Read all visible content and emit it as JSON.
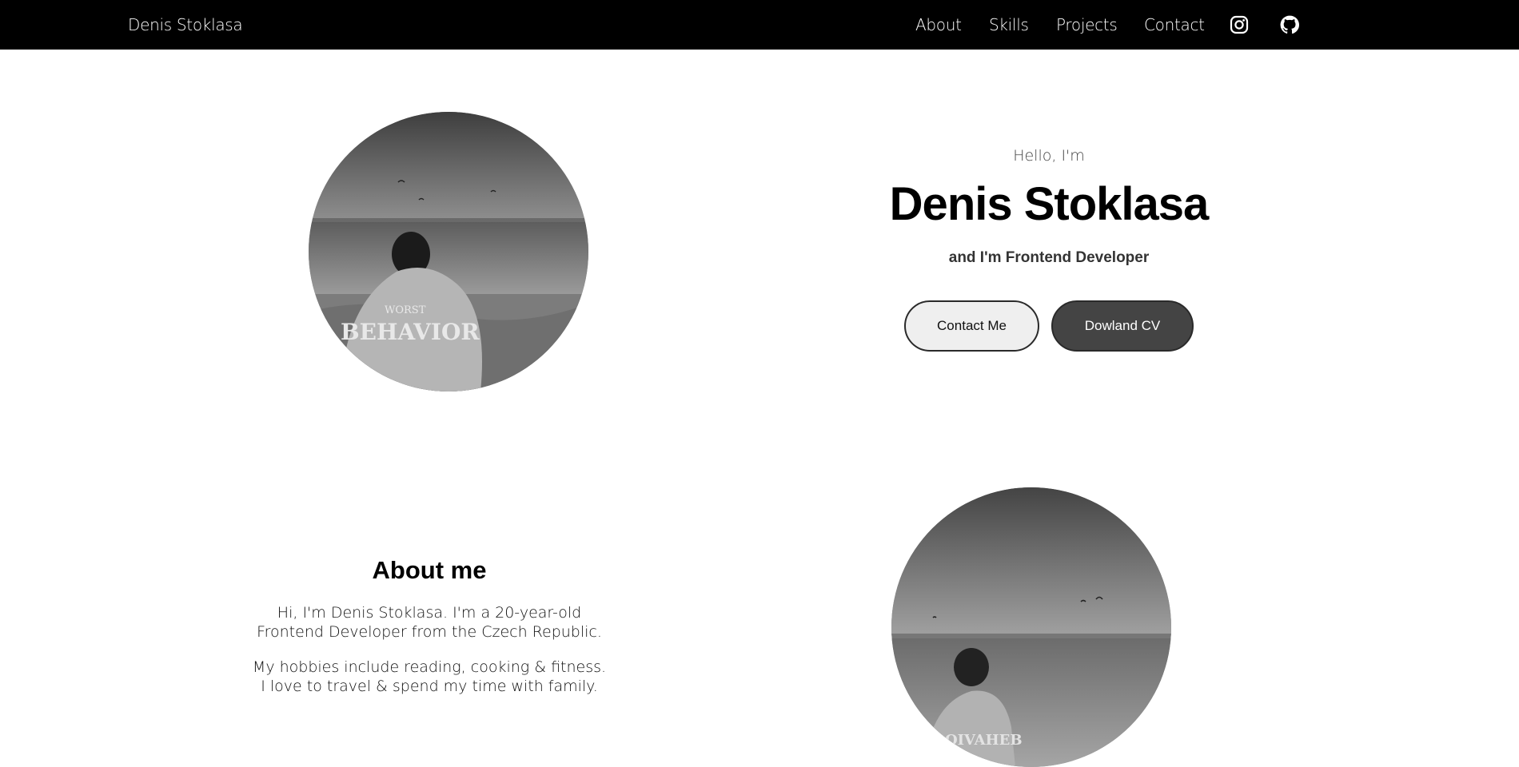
{
  "nav": {
    "brand": "Denis Stoklasa",
    "links": [
      "About",
      "Skills",
      "Projects",
      "Contact"
    ],
    "icons": [
      "instagram-icon",
      "github-icon"
    ]
  },
  "hero": {
    "greeting": "Hello, I'm",
    "name": "Denis Stoklasa",
    "role": "and I'm Frontend Developer",
    "contact_button": "Contact Me",
    "cv_button": "Dowland CV"
  },
  "about": {
    "title": "About me",
    "paragraph1_line1": "Hi, I'm Denis Stoklasa. I'm a 20-year-old",
    "paragraph1_line2": "Frontend Developer from the Czech Republic.",
    "paragraph2_line1": "My hobbies include reading, cooking & fitness.",
    "paragraph2_line2": "I love to travel & spend my time with family."
  },
  "colors": {
    "navbar_bg": "#000000",
    "page_bg": "#ffffff",
    "button_light": "#efefef",
    "button_dark": "#444444"
  }
}
